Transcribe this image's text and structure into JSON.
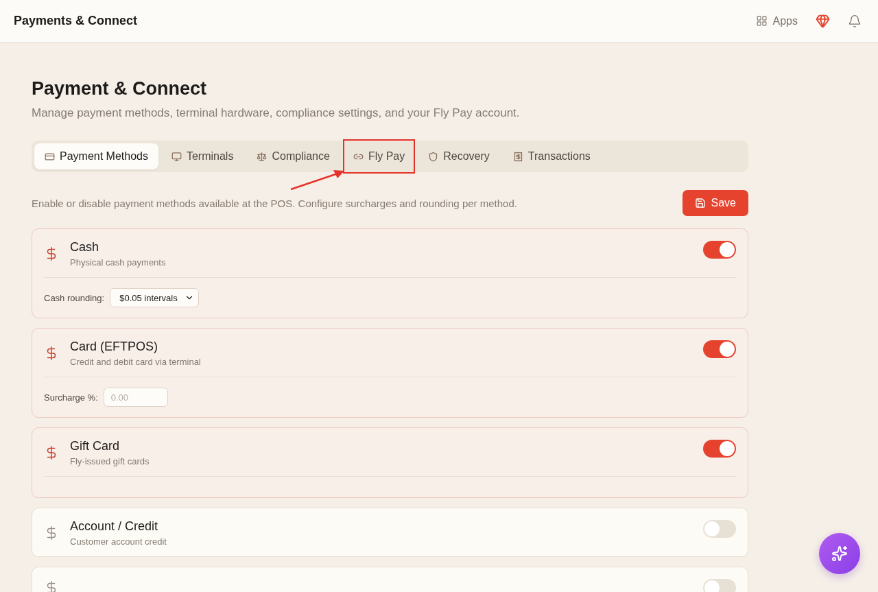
{
  "header": {
    "title": "Payments & Connect",
    "apps_label": "Apps"
  },
  "page": {
    "title": "Payment & Connect",
    "subtitle": "Manage payment methods, terminal hardware, compliance settings, and your Fly Pay account."
  },
  "tabs": [
    {
      "label": "Payment Methods",
      "selected": true,
      "highlighted": false
    },
    {
      "label": "Terminals",
      "selected": false,
      "highlighted": false
    },
    {
      "label": "Compliance",
      "selected": false,
      "highlighted": false
    },
    {
      "label": "Fly Pay",
      "selected": false,
      "highlighted": true
    },
    {
      "label": "Recovery",
      "selected": false,
      "highlighted": false
    },
    {
      "label": "Transactions",
      "selected": false,
      "highlighted": false
    }
  ],
  "description": "Enable or disable payment methods available at the POS. Configure surcharges and rounding per method.",
  "save_label": "Save",
  "methods": [
    {
      "name": "Cash",
      "detail": "Physical cash payments",
      "on": true,
      "setting": {
        "kind": "select",
        "label": "Cash rounding:",
        "value": "$0.05 intervals"
      }
    },
    {
      "name": "Card (EFTPOS)",
      "detail": "Credit and debit card via terminal",
      "on": true,
      "setting": {
        "kind": "input",
        "label": "Surcharge %:",
        "placeholder": "0.00"
      }
    },
    {
      "name": "Gift Card",
      "detail": "Fly-issued gift cards",
      "on": true,
      "setting": {
        "kind": "empty"
      }
    },
    {
      "name": "Account / Credit",
      "detail": "Customer account credit",
      "on": false
    },
    {
      "on": false
    }
  ]
}
